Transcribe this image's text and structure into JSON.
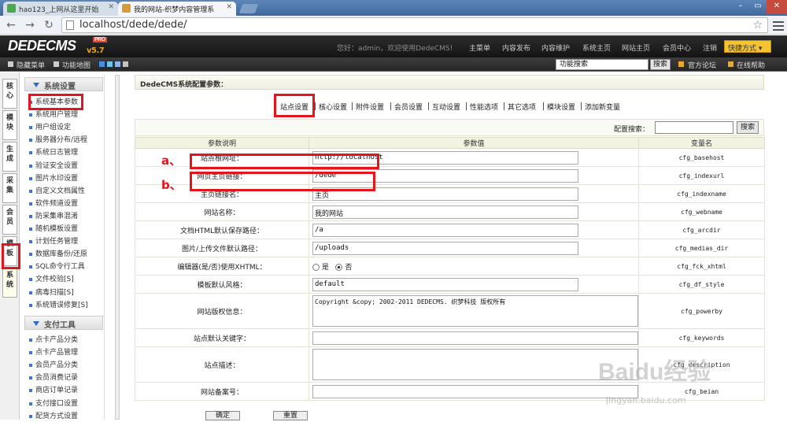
{
  "browser": {
    "tab1": "hao123_上网从这里开始",
    "tab2": "我的网站-织梦内容管理系",
    "url": "localhost/dede/dede/"
  },
  "header": {
    "logo": "DEDECMS",
    "version": "v5.7",
    "edition": "PRO",
    "welcome": "您好：admin，欢迎使用DedeCMS!",
    "nav": [
      "主菜单",
      "内容发布",
      "内容维护",
      "系统主页",
      "网站主页",
      "会员中心",
      "注销"
    ],
    "quick": "快捷方式"
  },
  "subbar": {
    "hide_menu": "隐藏菜单",
    "func_map": "功能地图",
    "search_value": "功能搜索",
    "search_btn": "搜索",
    "forum": "官方论坛",
    "help": "在线帮助"
  },
  "lefttabs": [
    "核心",
    "模块",
    "生成",
    "采集",
    "会员",
    "模板",
    "系统"
  ],
  "menu": {
    "section1": "系统设置",
    "items1": [
      "系统基本参数",
      "系统用户管理",
      "用户组设定",
      "服务器分布/远程",
      "系统日志管理",
      "验证安全设置",
      "图片水印设置",
      "自定义文档属性",
      "软件频道设置",
      "防采集串混淆",
      "随机模板设置",
      "计划任务管理",
      "数据库备份/还原",
      "SQL命令行工具",
      "文件校验[S]",
      "病毒扫描[S]",
      "系统错误修复[S]"
    ],
    "section2": "支付工具",
    "items2": [
      "点卡产品分类",
      "点卡产品管理",
      "会员产品分类",
      "会员消费记录",
      "商店订单记录",
      "支付接口设置",
      "配货方式设置"
    ]
  },
  "main": {
    "title": "DedeCMS系统配置参数：",
    "tabs": [
      "站点设置",
      "核心设置",
      "附件设置",
      "会员设置",
      "互动设置",
      "性能选项",
      "其它选项",
      "模块设置",
      "添加新变量"
    ],
    "search_label": "配置搜索：",
    "search_btn": "搜索",
    "col_headers": [
      "参数说明",
      "参数值",
      "变量名"
    ],
    "rows": [
      {
        "label": "站点根网址：",
        "value": "http://localhost",
        "var": "cfg_basehost"
      },
      {
        "label": "网页主页链接：",
        "value": "/dede",
        "var": "cfg_indexurl"
      },
      {
        "label": "主页链接名：",
        "value": "主页",
        "var": "cfg_indexname"
      },
      {
        "label": "网站名称：",
        "value": "我的网站",
        "var": "cfg_webname"
      },
      {
        "label": "文档HTML默认保存路径：",
        "value": "/a",
        "var": "cfg_arcdir"
      },
      {
        "label": "图片/上传文件默认路径：",
        "value": "/uploads",
        "var": "cfg_medias_dir"
      },
      {
        "label": "编辑器(是/否)使用XHTML：",
        "var": "cfg_fck_xhtml"
      },
      {
        "label": "模板默认风格：",
        "value": "default",
        "var": "cfg_df_style"
      },
      {
        "label": "网站版权信息：",
        "value": "Copyright &copy; 2002-2011 DEDECMS. 织梦科技 版权所有",
        "var": "cfg_powerby"
      },
      {
        "label": "站点默认关键字：",
        "value": "",
        "var": "cfg_keywords"
      },
      {
        "label": "站点描述：",
        "value": "",
        "var": "cfg_description"
      },
      {
        "label": "网站备案号：",
        "value": "",
        "var": "cfg_beian"
      }
    ],
    "radio_yes": "是",
    "radio_no": "否",
    "ok": "确定",
    "reset": "重置",
    "annot_a": "a、",
    "annot_b": "b、"
  },
  "watermark": {
    "big": "Baidu经验",
    "small": "jingyan.baidu.com"
  }
}
